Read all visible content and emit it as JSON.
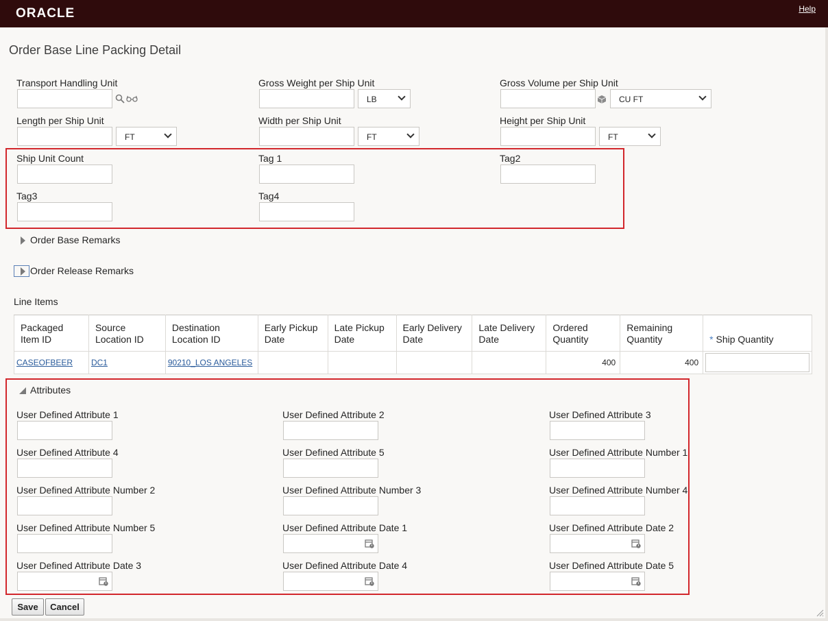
{
  "header": {
    "logo": "ORACLE",
    "help": "Help"
  },
  "page_title": "Order Base Line Packing Detail",
  "packing": {
    "transport_handling_unit": "Transport Handling Unit",
    "gross_weight": "Gross Weight per Ship Unit",
    "gross_weight_uom": "LB",
    "gross_volume": "Gross Volume per Ship Unit",
    "gross_volume_uom": "CU FT",
    "length": "Length per Ship Unit",
    "length_uom": "FT",
    "width": "Width per Ship Unit",
    "width_uom": "FT",
    "height": "Height per Ship Unit",
    "height_uom": "FT",
    "ship_unit_count": "Ship Unit Count",
    "tag1": "Tag 1",
    "tag2": "Tag2",
    "tag3": "Tag3",
    "tag4": "Tag4"
  },
  "sections": {
    "order_base_remarks": "Order Base Remarks",
    "order_release_remarks": "Order Release Remarks",
    "line_items": "Line Items",
    "attributes": "Attributes"
  },
  "line_items": {
    "columns": [
      "Packaged Item ID",
      "Source Location ID",
      "Destination Location ID",
      "Early Pickup Date",
      "Late Pickup Date",
      "Early Delivery Date",
      "Late Delivery Date",
      "Ordered Quantity",
      "Remaining Quantity",
      "Ship Quantity"
    ],
    "required_mark": "*",
    "row": {
      "packaged_item": "CASEOFBEER",
      "source": "DC1",
      "destination": "90210_LOS ANGELES",
      "ordered": "400",
      "remaining": "400"
    }
  },
  "attributes": [
    "User Defined Attribute 1",
    "User Defined Attribute 2",
    "User Defined Attribute 3",
    "User Defined Attribute 4",
    "User Defined Attribute 5",
    "User Defined Attribute Number 1",
    "User Defined Attribute Number 2",
    "User Defined Attribute Number 3",
    "User Defined Attribute Number 4",
    "User Defined Attribute Number 5",
    "User Defined Attribute Date 1",
    "User Defined Attribute Date 2",
    "User Defined Attribute Date 3",
    "User Defined Attribute Date 4",
    "User Defined Attribute Date 5"
  ],
  "buttons": {
    "save": "Save",
    "cancel": "Cancel"
  },
  "colors": {
    "header_bg": "#2f0b0c",
    "highlight_border": "#d2262b",
    "link": "#2a5b9b"
  },
  "icons": [
    "search-icon",
    "glasses-icon",
    "cube-icon",
    "calendar-icon",
    "resize-grip-icon"
  ]
}
